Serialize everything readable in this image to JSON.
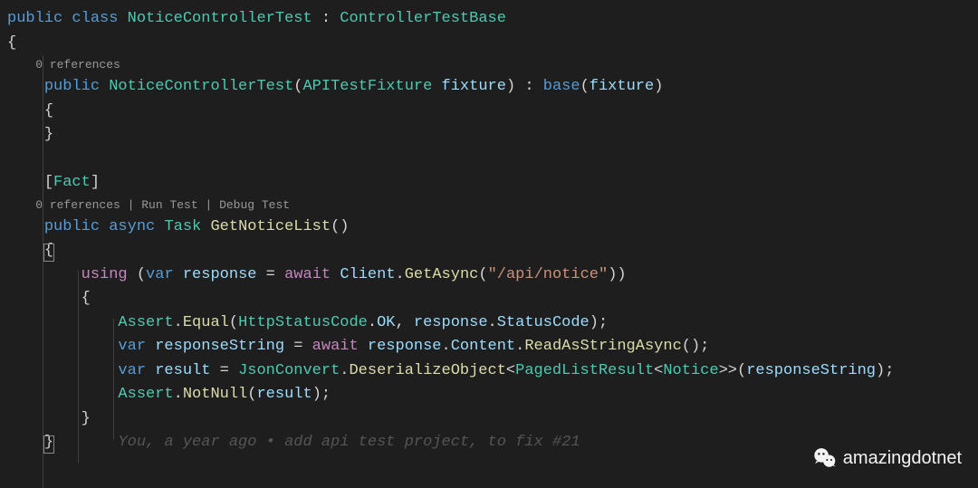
{
  "colors": {
    "keyword": "#569cd6",
    "type": "#4ec9b0",
    "control": "#c586c0",
    "method": "#dcdcaa",
    "string": "#ce9178",
    "variable": "#9cdcfe",
    "text": "#d4d4d4",
    "codelens": "#999999",
    "gitlens": "#555555"
  },
  "code": {
    "l1": {
      "public": "public",
      "class": "class",
      "name": "NoticeControllerTest",
      "colon": " : ",
      "base": "ControllerTestBase"
    },
    "l2": "{",
    "codelens1": "0 references",
    "l3": {
      "public": "public",
      "name": "NoticeControllerTest",
      "open": "(",
      "paramType": "APITestFixture",
      "paramName": "fixture",
      "close": ") : ",
      "base": "base",
      "open2": "(",
      "arg": "fixture",
      "close2": ")"
    },
    "l4": "{",
    "l5": "}",
    "l6_attr": {
      "open": "[",
      "name": "Fact",
      "close": "]"
    },
    "codelens2": {
      "refs": "0 references",
      "sep1": " | ",
      "run": "Run Test",
      "sep2": " | ",
      "debug": "Debug Test"
    },
    "l7": {
      "public": "public",
      "async": "async",
      "task": "Task",
      "method": "GetNoticeList",
      "parens": "()"
    },
    "l8": "{",
    "l9": {
      "using": "using",
      "open": " (",
      "var": "var",
      "resp": "response",
      "eq": " = ",
      "await": "await",
      "client": "Client",
      "dot": ".",
      "getasync": "GetAsync",
      "open2": "(",
      "str": "\"/api/notice\"",
      "close": "))"
    },
    "l10": "{",
    "l11": {
      "assert": "Assert",
      "dot1": ".",
      "equal": "Equal",
      "open": "(",
      "httpcode": "HttpStatusCode",
      "dot2": ".",
      "ok": "OK",
      "comma": ", ",
      "response": "response",
      "dot3": ".",
      "status": "StatusCode",
      "close": ");"
    },
    "l12": {
      "var": "var",
      "name": "responseString",
      "eq": " = ",
      "await": "await",
      "response": "response",
      "dot1": ".",
      "content": "Content",
      "dot2": ".",
      "read": "ReadAsStringAsync",
      "parens": "();"
    },
    "l13": {
      "var": "var",
      "name": "result",
      "eq": " = ",
      "jsonconvert": "JsonConvert",
      "dot": ".",
      "deser": "DeserializeObject",
      "lt": "<",
      "paged": "PagedListResult",
      "lt2": "<",
      "notice": "Notice",
      "gt": ">>(",
      "arg": "responseString",
      "close": ");"
    },
    "l14": {
      "assert": "Assert",
      "dot": ".",
      "notnull": "NotNull",
      "open": "(",
      "arg": "result",
      "close": ");"
    },
    "l15": "}",
    "l16": "}",
    "gitlens": "You, a year ago • add api test project, to fix #21"
  },
  "watermark": {
    "text": "amazingdotnet",
    "icon": "wechat-icon"
  }
}
